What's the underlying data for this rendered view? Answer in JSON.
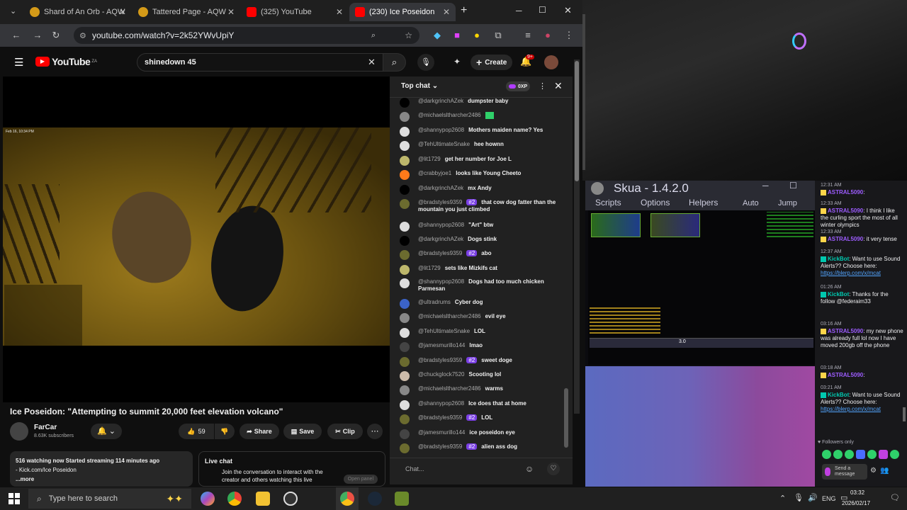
{
  "browser": {
    "tabs": [
      {
        "title": "Shard of An Orb - AQW",
        "color": "#e0a020"
      },
      {
        "title": "Tattered Page - AQW",
        "color": "#e0a020"
      },
      {
        "title": "(325) YouTube",
        "color": "#ff0000"
      },
      {
        "title": "(230) Ice Poseidon",
        "color": "#ff0000"
      }
    ],
    "new_tab": "+",
    "url": "youtube.com/watch?v=2k52YWvUpiY"
  },
  "youtube": {
    "logo": "YouTube",
    "logo_region": "ZA",
    "search_value": "shinedown 45",
    "create_label": "Create",
    "notif_count": "9+",
    "video_overlay_date": "Feb 16, 10:34 PM",
    "video_title": "Ice Poseidon: \"Attempting to summit 20,000 feet elevation volcano\"",
    "channel": "FarCar",
    "subscribers": "8.63K subscribers",
    "likes": "59",
    "share": "Share",
    "save": "Save",
    "clip": "Clip",
    "desc_line1": "516 watching now  Started streaming 114 minutes ago",
    "desc_line2": "- Kick.com/Ice Poseidon",
    "desc_more": "...more",
    "live_chat_title": "Live chat",
    "live_chat_body": "Join the conversation to interact with the creator and others watching this live",
    "open_panel": "Open panel"
  },
  "chat": {
    "header": "Top chat",
    "xp": "0XP",
    "input_placeholder": "Chat...",
    "messages": [
      {
        "name": "@darkgrinchAZek",
        "text": "dumpster baby",
        "badge": "",
        "color": "#000"
      },
      {
        "name": "@michaelsltharcher2486",
        "text": "",
        "badge": "",
        "color": "#888",
        "emote": true
      },
      {
        "name": "@shannypop2608",
        "text": "Mothers maiden name? Yes",
        "badge": "",
        "color": "#ddd"
      },
      {
        "name": "@TehUltimateSnake",
        "text": "hee hownn",
        "badge": "",
        "color": "#ddd"
      },
      {
        "name": "@lit1729",
        "text": "get her number for Joe L",
        "badge": "",
        "color": "#bdb76b"
      },
      {
        "name": "@crabbyjoe1",
        "text": "looks like Young Cheeto",
        "badge": "",
        "color": "#ff7a1a"
      },
      {
        "name": "@darkgrinchAZek",
        "text": "mx Andy",
        "badge": "",
        "color": "#000"
      },
      {
        "name": "@bradstyles9359",
        "text": "that cow dog fatter than the mountain you just climbed",
        "badge": "#2",
        "color": "#6b6b2f"
      },
      {
        "name": "@shannypop2608",
        "text": "\"Art\" btw",
        "badge": "",
        "color": "#ddd"
      },
      {
        "name": "@darkgrinchAZek",
        "text": "Dogs stink",
        "badge": "",
        "color": "#000"
      },
      {
        "name": "@bradstyles9359",
        "text": "abo",
        "badge": "#2",
        "color": "#6b6b2f"
      },
      {
        "name": "@lit1729",
        "text": "sets like Mizkifs cat",
        "badge": "",
        "color": "#bdb76b"
      },
      {
        "name": "@shannypop2608",
        "text": "Dogs had too much chicken Parmesan",
        "badge": "",
        "color": "#ddd"
      },
      {
        "name": "@ultradrums",
        "text": "Cyber dog",
        "badge": "",
        "color": "#3b63c8"
      },
      {
        "name": "@michaelsltharcher2486",
        "text": "evil eye",
        "badge": "",
        "color": "#888"
      },
      {
        "name": "@TehUltimateSnake",
        "text": "LOL",
        "badge": "",
        "color": "#ddd"
      },
      {
        "name": "@jamesmurillo144",
        "text": "lmao",
        "badge": "",
        "color": "#444"
      },
      {
        "name": "@bradstyles9359",
        "text": "sweet doge",
        "badge": "#2",
        "color": "#6b6b2f"
      },
      {
        "name": "@chuckglock7520",
        "text": "Scooting lol",
        "badge": "",
        "color": "#cba"
      },
      {
        "name": "@michaelsltharcher2486",
        "text": "warms",
        "badge": "",
        "color": "#888"
      },
      {
        "name": "@shannypop2608",
        "text": "Ice does that at home",
        "badge": "",
        "color": "#ddd"
      },
      {
        "name": "@bradstyles9359",
        "text": "LOL",
        "badge": "#2",
        "color": "#6b6b2f"
      },
      {
        "name": "@jamesmurillo144",
        "text": "ice poseidon eye",
        "badge": "",
        "color": "#444"
      },
      {
        "name": "@bradstyles9359",
        "text": "alien ass dog",
        "badge": "#2",
        "color": "#6b6b2f"
      }
    ]
  },
  "skua": {
    "title": "Skua - 1.4.2.0",
    "menu": [
      "Scripts",
      "Options",
      "Helpers"
    ],
    "auto": "Auto",
    "jump": "Jump",
    "level": "3.0"
  },
  "twitch": {
    "entries": [
      {
        "time": "12:31 AM",
        "name": "ASTRAL5090",
        "text": ":",
        "kind": "user"
      },
      {
        "time": "12:33 AM",
        "name": "ASTRAL5090",
        "text": ": I think I like the curling sport the most of all winter olympics",
        "kind": "user"
      },
      {
        "time": "12:33 AM",
        "name": "ASTRAL5090",
        "text": ": it very tense",
        "kind": "user"
      },
      {
        "time": "12:37 AM",
        "name": "KickBot",
        "text": ": Want to use Sound Alerts?? Choose here:",
        "link": "https://blerp.com/x/mcat",
        "kind": "bot"
      },
      {
        "time": "01:26 AM",
        "name": "KickBot",
        "text": ": Thanks for the follow @federaim33",
        "kind": "bot"
      },
      {
        "time": "03:16 AM",
        "name": "ASTRAL5090",
        "text": ": my new phone was already full lol now I have moved 200gb off the phone",
        "kind": "user"
      },
      {
        "time": "03:18 AM",
        "name": "ASTRAL5090",
        "text": ":",
        "kind": "user"
      },
      {
        "time": "03:21 AM",
        "name": "KickBot",
        "text": ": Want to use Sound Alerts?? Choose here:",
        "link": "https://blerp.com/x/mcat",
        "kind": "bot"
      }
    ],
    "followers_only": "Followers only",
    "send_placeholder": "Send a message"
  },
  "taskbar": {
    "search_placeholder": "Type here to search",
    "lang": "ENG",
    "time": "03:32",
    "date": "2026/02/17"
  }
}
